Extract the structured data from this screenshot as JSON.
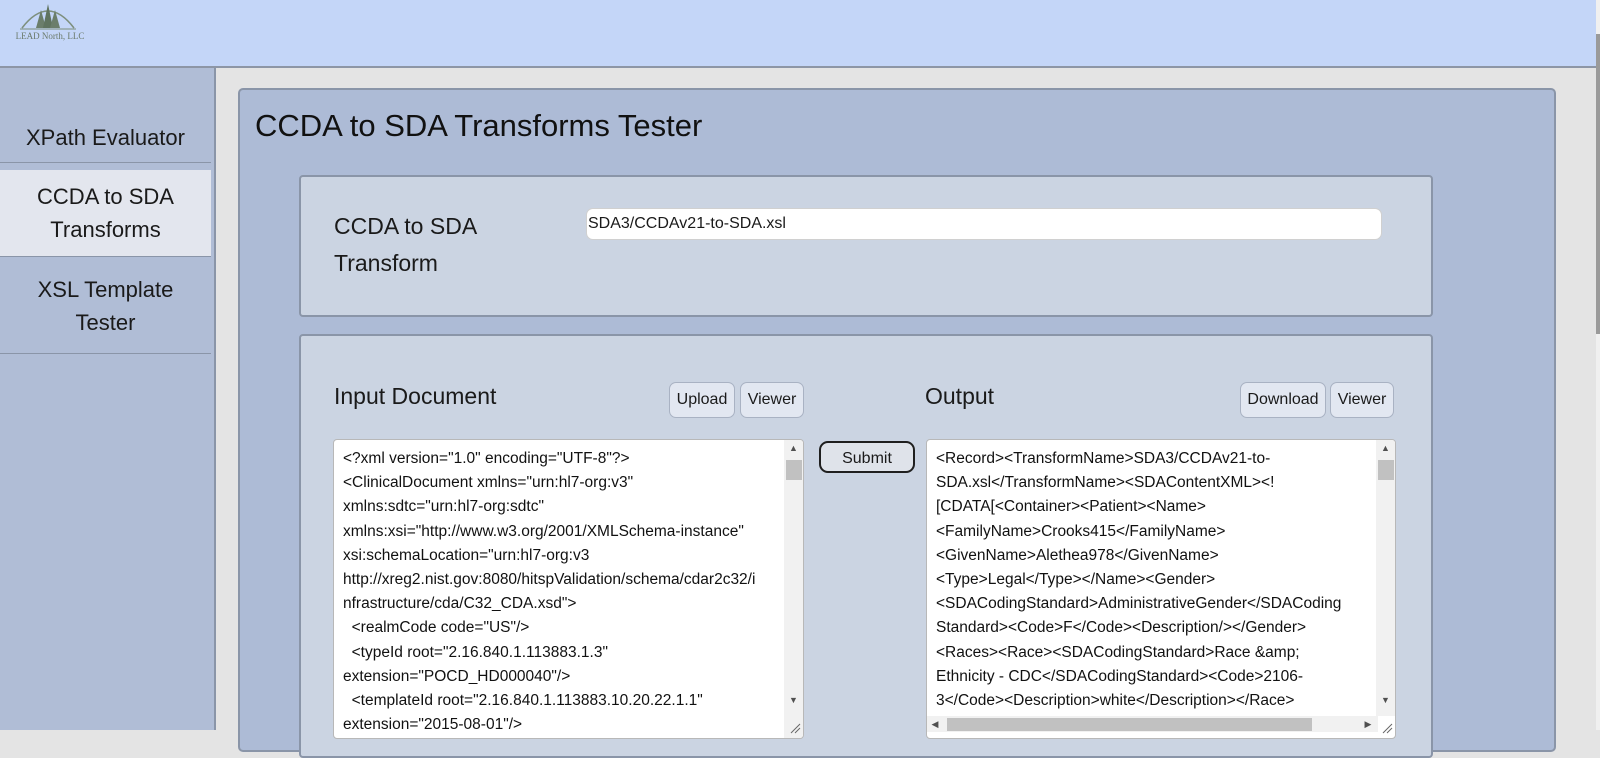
{
  "header": {
    "logo_text": "LEAD North, LLC"
  },
  "sidebar": {
    "items": [
      {
        "label": "XPath Evaluator",
        "active": false
      },
      {
        "label": "CCDA to SDA Transforms",
        "active": true
      },
      {
        "label": "XSL Template Tester",
        "active": false
      }
    ]
  },
  "page": {
    "title": "CCDA to SDA Transforms Tester"
  },
  "transform": {
    "label": "CCDA to SDA Transform",
    "value": "SDA3/CCDAv21-to-SDA.xsl"
  },
  "input": {
    "label": "Input Document",
    "upload_label": "Upload",
    "viewer_label": "Viewer",
    "content": "<?xml version=\"1.0\" encoding=\"UTF-8\"?>\n<ClinicalDocument xmlns=\"urn:hl7-org:v3\"\nxmlns:sdtc=\"urn:hl7-org:sdtc\"\nxmlns:xsi=\"http://www.w3.org/2001/XMLSchema-instance\"\nxsi:schemaLocation=\"urn:hl7-org:v3\nhttp://xreg2.nist.gov:8080/hitspValidation/schema/cdar2c32/i\nnfrastructure/cda/C32_CDA.xsd\">\n  <realmCode code=\"US\"/>\n  <typeId root=\"2.16.840.1.113883.1.3\"\nextension=\"POCD_HD000040\"/>\n  <templateId root=\"2.16.840.1.113883.10.20.22.1.1\"\nextension=\"2015-08-01\"/>"
  },
  "submit_label": "Submit",
  "output": {
    "label": "Output",
    "download_label": "Download",
    "viewer_label": "Viewer",
    "content": "<Record><TransformName>SDA3/CCDAv21-to-\nSDA.xsl</TransformName><SDAContentXML><!\n[CDATA[<Container><Patient><Name>\n<FamilyName>Crooks415</FamilyName>\n<GivenName>Alethea978</GivenName>\n<Type>Legal</Type></Name><Gender>\n<SDACodingStandard>AdministrativeGender</SDACoding\nStandard><Code>F</Code><Description/></Gender>\n<Races><Race><SDACodingStandard>Race &amp;\nEthnicity - CDC</SDACodingStandard><Code>2106-\n3</Code><Description>white</Description></Race>"
  },
  "colors": {
    "header_bg": "#c4d6f8",
    "sidebar_bg": "#b0bdd6",
    "panel_bg": "#adbbd6",
    "card_bg": "#cbd4e2",
    "active_nav_bg": "#e3e6ee"
  },
  "icons": {
    "logo": "pine-trees-logo-icon",
    "scroll_up": "triangle-up-icon",
    "scroll_down": "triangle-down-icon",
    "scroll_left": "triangle-left-icon",
    "scroll_right": "triangle-right-icon",
    "resize": "resize-grip-icon"
  }
}
